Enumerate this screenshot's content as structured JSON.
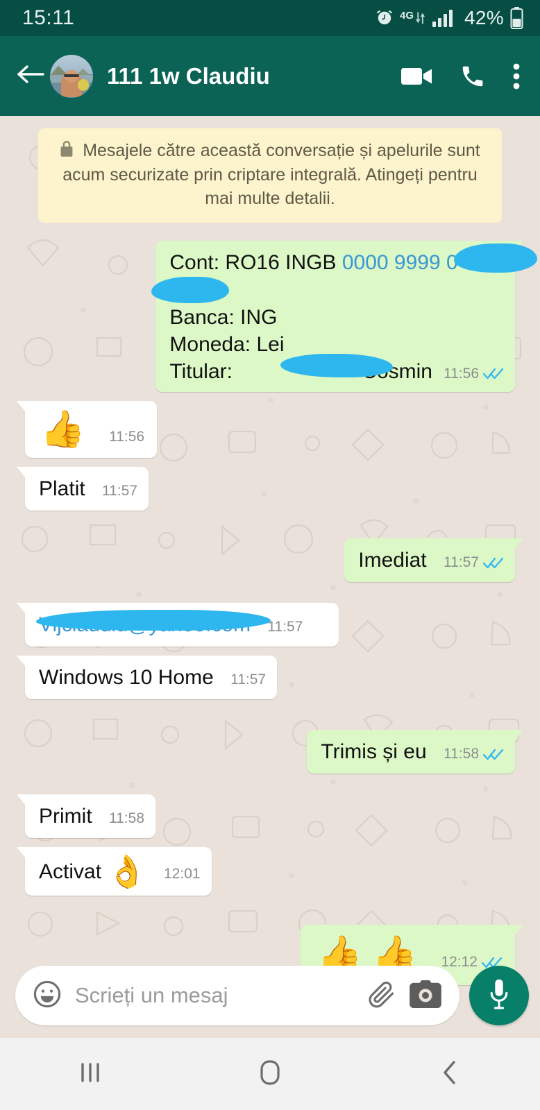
{
  "status_bar": {
    "clock": "15:11",
    "alarm_icon": "alarm-clock-icon",
    "network_type": "4G",
    "signal_icon": "signal-bars-icon",
    "battery_percent": "42%",
    "battery_icon": "battery-icon"
  },
  "header": {
    "back_icon": "back-arrow-icon",
    "avatar": "contact-avatar",
    "title": "111 1w Claudiu",
    "video_call_icon": "video-camera-icon",
    "voice_call_icon": "phone-icon",
    "overflow_icon": "more-vertical-icon"
  },
  "encryption_notice": {
    "lock_icon": "lock-icon",
    "text": "Mesajele către această conversație și apelurile sunt acum securizate prin criptare integrală. Atingeți pentru mai multe detalii."
  },
  "messages": [
    {
      "direction": "out",
      "type": "bank-details",
      "lines": [
        {
          "label": "Cont: RO16 INGB ",
          "link": "0000 9999",
          "redacted": true
        },
        {
          "label": "",
          "redacted": true
        },
        {
          "label": "Banca: ING"
        },
        {
          "label": "Moneda: Lei"
        },
        {
          "label": "Titular: ",
          "redacted": true,
          "suffix": "Cosmin"
        }
      ],
      "time": "11:56",
      "status": "read"
    },
    {
      "direction": "in",
      "type": "emoji",
      "emoji": "👍",
      "time": "11:56"
    },
    {
      "direction": "in",
      "type": "text",
      "text": "Platit",
      "time": "11:57"
    },
    {
      "direction": "out",
      "type": "text",
      "text": "Imediat",
      "time": "11:57",
      "status": "read"
    },
    {
      "direction": "in",
      "type": "link-redacted",
      "text": "Vijclaudiu@yahoo.com",
      "time": "11:57"
    },
    {
      "direction": "in",
      "type": "text",
      "text": "Windows 10 Home",
      "time": "11:57"
    },
    {
      "direction": "out",
      "type": "text",
      "text": "Trimis și eu",
      "time": "11:58",
      "status": "read"
    },
    {
      "direction": "in",
      "type": "text",
      "text": "Primit",
      "time": "11:58"
    },
    {
      "direction": "in",
      "type": "text-emoji",
      "text": "Activat ",
      "emoji": "👌",
      "time": "12:01"
    },
    {
      "direction": "out",
      "type": "emoji",
      "emoji": "👍 👍",
      "time": "12:12",
      "status": "read"
    }
  ],
  "input_bar": {
    "emoji_icon": "smiley-icon",
    "placeholder": "Scrieți un mesaj",
    "attach_icon": "paperclip-icon",
    "camera_icon": "camera-icon",
    "mic_icon": "microphone-icon"
  },
  "nav_bar": {
    "recents_icon": "recents-icon",
    "home_icon": "home-icon",
    "back_icon": "back-icon"
  },
  "colors": {
    "status_bar": "#064e44",
    "header": "#0a6355",
    "chat_background": "#e9e1da",
    "outgoing_bubble": "#dcf8c6",
    "incoming_bubble": "#ffffff",
    "notice_background": "#fdf4cd",
    "link": "#3997d4",
    "redaction": "#2eb6ef",
    "tick_read": "#34b7f1",
    "mic_button": "#088069"
  }
}
